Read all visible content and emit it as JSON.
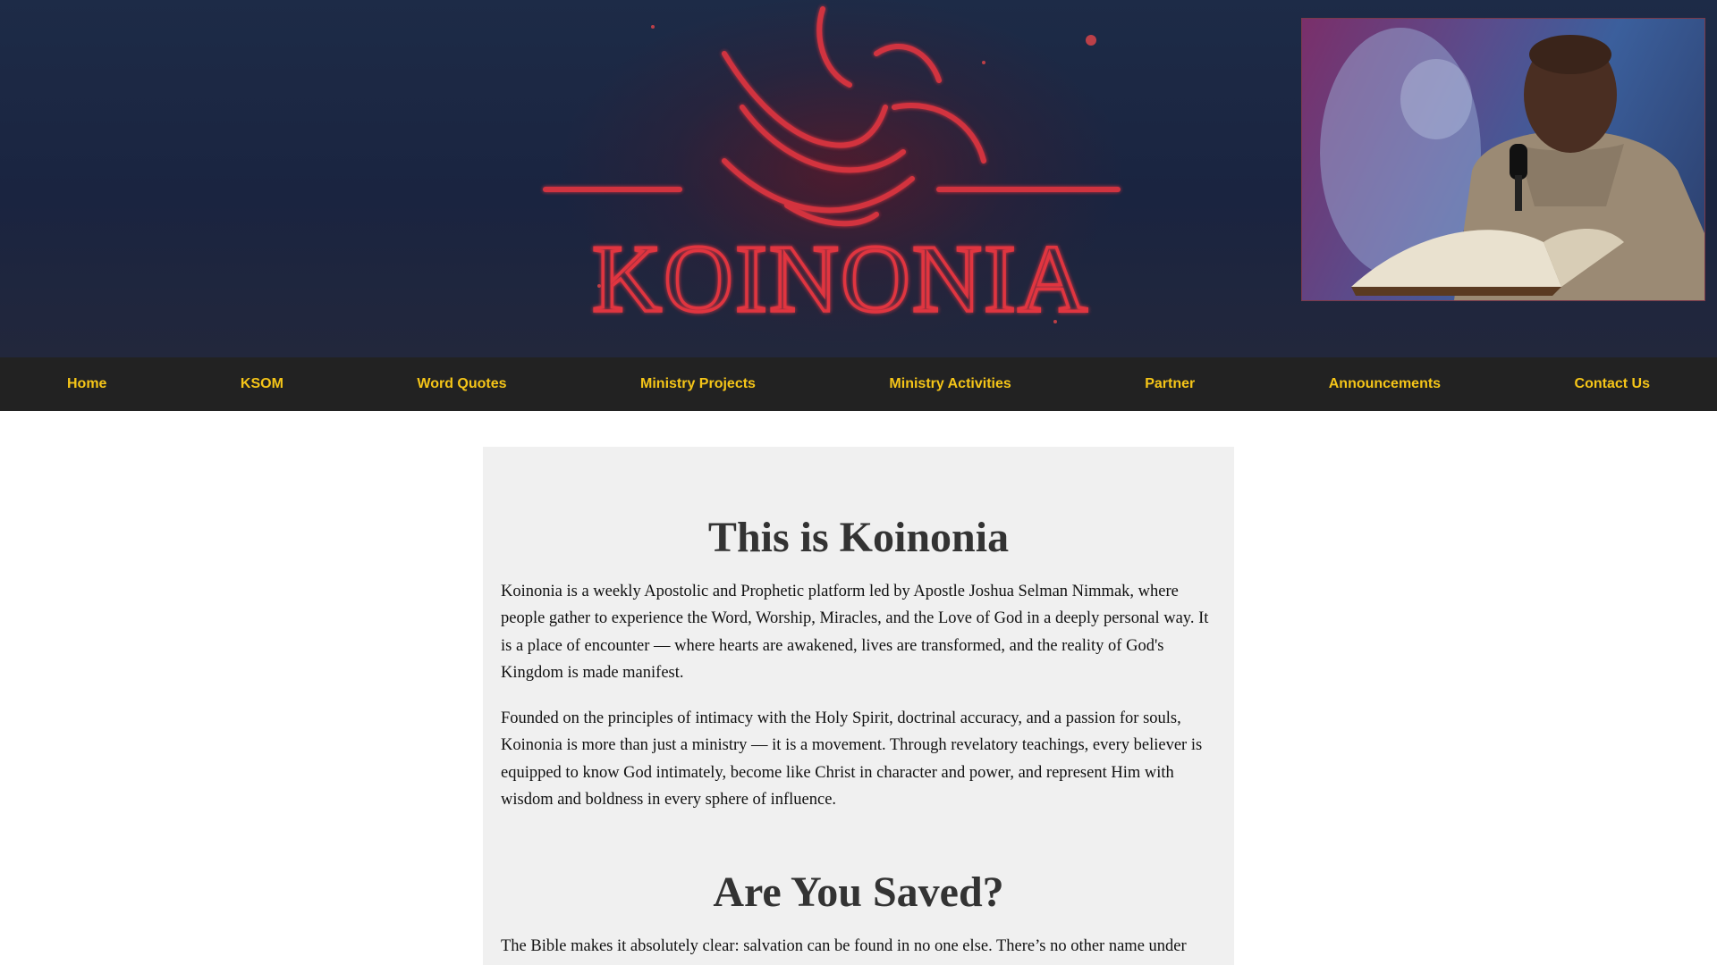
{
  "hero": {
    "logo_text": "KOINONIA",
    "portrait_icon": "preacher-portrait-icon",
    "colors": {
      "background": "#1d2b47",
      "logo_red": "#e0353f"
    }
  },
  "nav": {
    "items": [
      {
        "label": "Home"
      },
      {
        "label": "KSOM"
      },
      {
        "label": "Word Quotes"
      },
      {
        "label": "Ministry Projects"
      },
      {
        "label": "Ministry Activities"
      },
      {
        "label": "Partner"
      },
      {
        "label": "Announcements"
      },
      {
        "label": "Contact Us"
      }
    ],
    "colors": {
      "background": "#222222",
      "text": "#f5c518"
    }
  },
  "main": {
    "sections": [
      {
        "title": "This is Koinonia",
        "paragraphs": [
          "Koinonia is a weekly Apostolic and Prophetic platform led by Apostle Joshua Selman Nimmak, where people gather to experience the Word, Worship, Miracles, and the Love of God in a deeply personal way. It is a place of encounter — where hearts are awakened, lives are transformed, and the reality of God's Kingdom is made manifest.",
          "Founded on the principles of intimacy with the Holy Spirit, doctrinal accuracy, and a passion for souls, Koinonia is more than just a ministry — it is a movement. Through revelatory teachings, every believer is equipped to know God intimately, become like Christ in character and power, and represent Him with wisdom and boldness in every sphere of influence."
        ]
      },
      {
        "title": "Are You Saved?",
        "paragraphs": [
          "The Bible makes it absolutely clear: salvation can be found in no one else. There’s no other name under"
        ]
      }
    ],
    "colors": {
      "card_background": "#f0f0f0",
      "heading": "#333333"
    }
  }
}
